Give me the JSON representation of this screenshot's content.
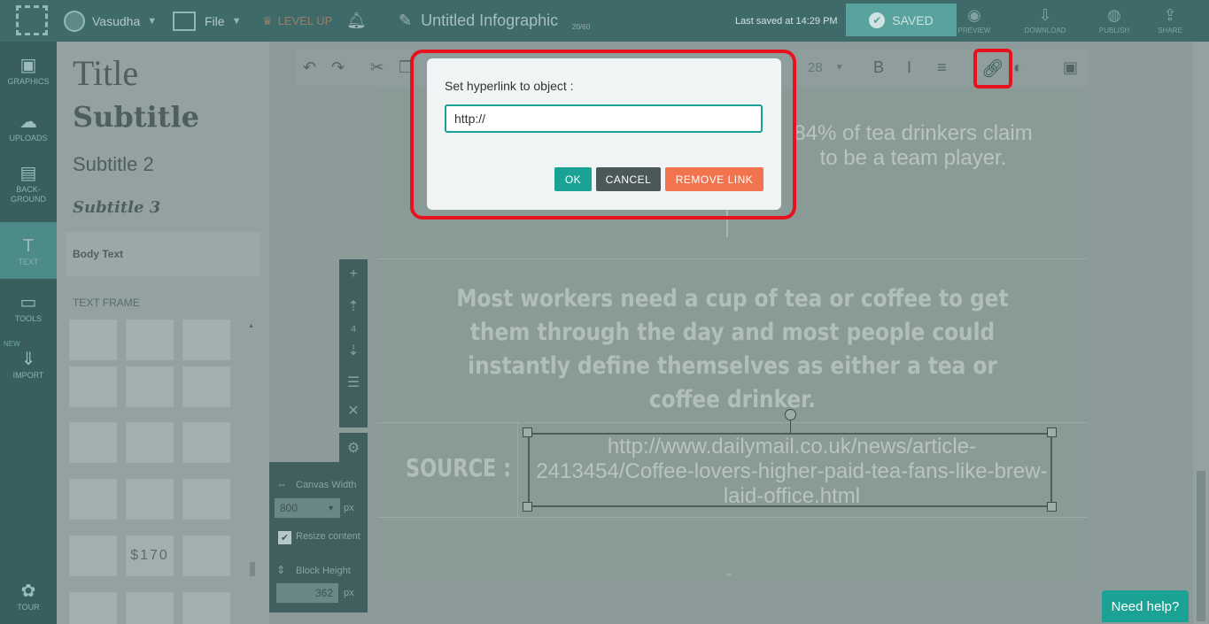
{
  "topbar": {
    "user": "Vasudha",
    "file_label": "File",
    "levelup_label": "LEVEL UP",
    "doc_title": "Untitled Infographic",
    "char_count": "20/60",
    "last_saved": "Last saved at 14:29 PM",
    "saved_label": "SAVED",
    "actions": [
      {
        "label": "PREVIEW",
        "icon": "eye-icon"
      },
      {
        "label": "DOWNLOAD",
        "icon": "download-icon"
      },
      {
        "label": "PUBLISH",
        "icon": "globe-icon"
      },
      {
        "label": "SHARE",
        "icon": "share-icon"
      }
    ]
  },
  "sidebar": {
    "items": [
      {
        "label": "GRAPHICS",
        "icon": "image-icon"
      },
      {
        "label": "UPLOADS",
        "icon": "cloud-upload-icon"
      },
      {
        "label": "BACK-\nGROUND",
        "icon": "background-icon"
      },
      {
        "label": "TEXT",
        "icon": "text-icon"
      },
      {
        "label": "TOOLS",
        "icon": "tools-icon"
      },
      {
        "label": "IMPORT",
        "icon": "import-icon"
      },
      {
        "label": "TOUR",
        "icon": "tour-icon"
      }
    ],
    "new_badge": "NEW"
  },
  "panel": {
    "title": "Title",
    "subtitle": "Subtitle",
    "subtitle2": "Subtitle 2",
    "subtitle3": "Subtitle 3",
    "body_text": "Body Text",
    "text_frame": "TEXT FRAME",
    "price_frame": "$170"
  },
  "toolbar": {
    "font_size": "28"
  },
  "canvas": {
    "stat": "84% of tea drinkers claim to be a team player.",
    "main_text": "Most workers need a cup of tea or coffee to get them through the day and most people could instantly define themselves as either a tea or coffee drinker.",
    "source_label": "SOURCE :",
    "source_url": "http://www.dailymail.co.uk/news/article-2413454/Coffee-lovers-higher-paid-tea-fans-like-brew-laid-office.html"
  },
  "settings": {
    "canvas_width_label": "Canvas Width",
    "canvas_width_value": "800",
    "unit": "px",
    "resize_label": "Resize content",
    "block_height_label": "Block Height",
    "block_height_value": "362"
  },
  "modal": {
    "title": "Set hyperlink to object :",
    "input_value": "http://",
    "ok": "OK",
    "cancel": "CANCEL",
    "remove": "REMOVE LINK"
  },
  "help": "Need help?",
  "colors": {
    "accent": "#1aa394",
    "remove_button": "#f2744f",
    "cancel_button": "#4a5858",
    "highlight": "#e8111e"
  }
}
